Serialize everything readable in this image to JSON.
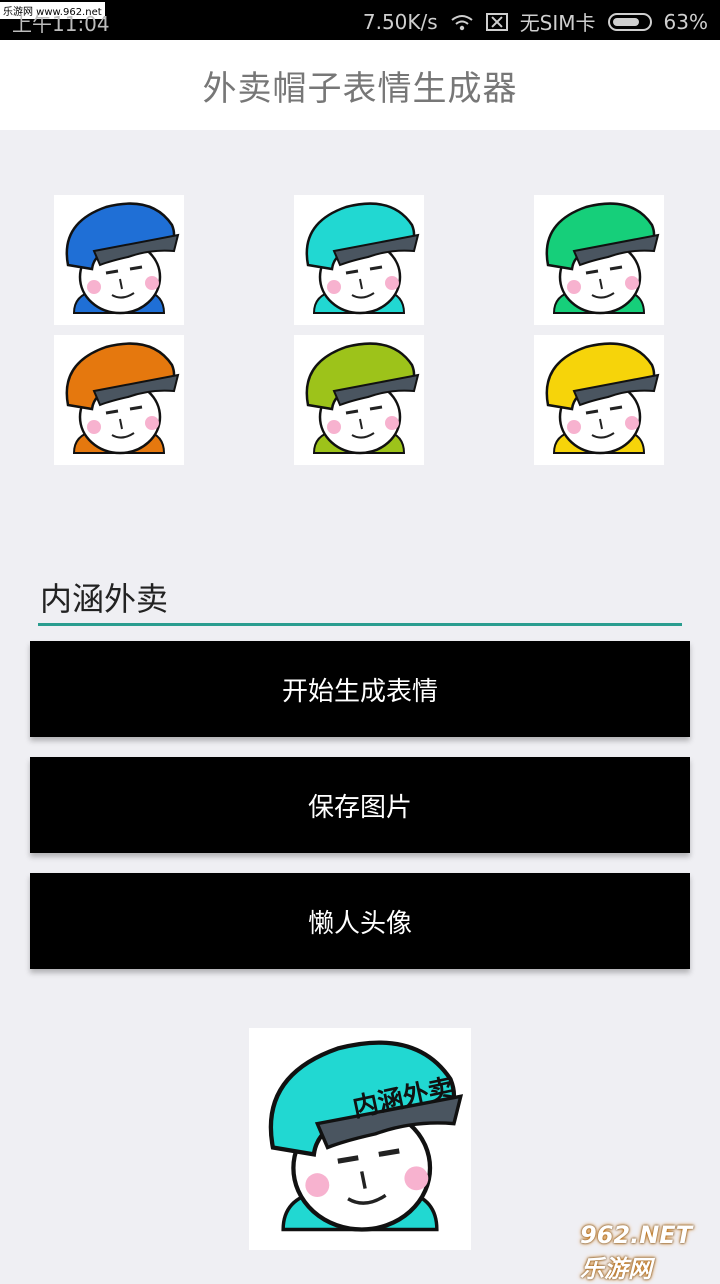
{
  "status": {
    "time": "上午11:04",
    "speed": "7.50K/s",
    "sim": "无SIM卡",
    "battery": "63%",
    "site_watermark": "乐游网 www.962.net"
  },
  "appbar": {
    "title": "外卖帽子表情生成器"
  },
  "helmets": [
    {
      "color": "#1f6fd6",
      "name": "blue"
    },
    {
      "color": "#21d8d2",
      "name": "cyan"
    },
    {
      "color": "#16cf7a",
      "name": "green"
    },
    {
      "color": "#e5780e",
      "name": "orange"
    },
    {
      "color": "#9dc31a",
      "name": "lime"
    },
    {
      "color": "#f6d40a",
      "name": "yellow"
    }
  ],
  "input": {
    "value": "内涵外卖"
  },
  "buttons": {
    "generate": "开始生成表情",
    "save": "保存图片",
    "lazy": "懒人头像"
  },
  "preview": {
    "helmet_color": "#21d8d2",
    "caption": "内涵外卖"
  },
  "bottom_watermark": "962.NET 乐游网"
}
